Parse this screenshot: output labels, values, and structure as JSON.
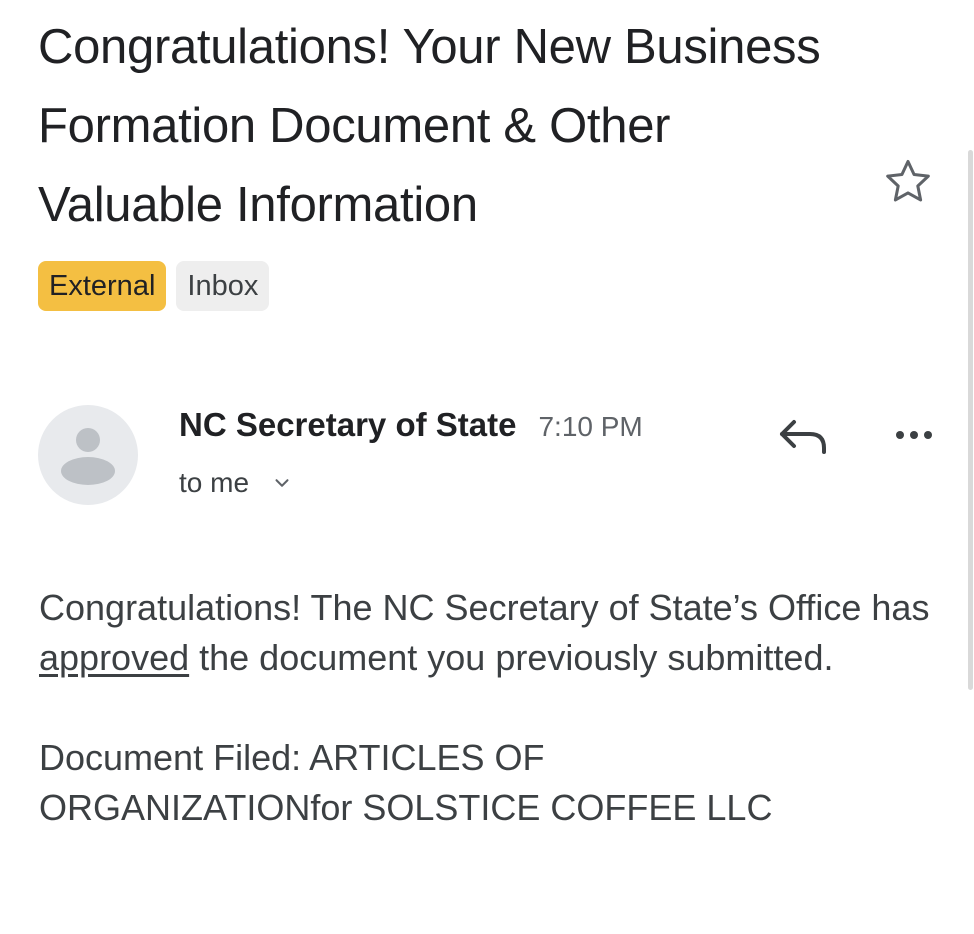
{
  "email": {
    "subject": "Congratulations! Your New Business Formation Document & Other Valuable Information",
    "labels": [
      "External",
      "Inbox"
    ],
    "sender": "NC Secretary of State",
    "time": "7:10 PM",
    "recipient": "to me",
    "body": {
      "p1_before": "Congratulations! The NC Secretary of State’s Office has ",
      "p1_link": "approved",
      "p1_after": " the document you previously submitted.",
      "p2_line1": "Document Filed: ARTICLES OF",
      "p2_line2": "ORGANIZATIONfor SOLSTICE COFFEE LLC"
    }
  },
  "icons": {
    "star": "star-outline-icon",
    "reply": "reply-icon",
    "more": "more-horizontal-icon",
    "expand": "chevron-down-icon",
    "avatar": "person-icon"
  },
  "colors": {
    "external_label": "#f4bf42",
    "inbox_label": "#eeeeee",
    "text_primary": "#202124",
    "text_secondary": "#5f6368"
  }
}
